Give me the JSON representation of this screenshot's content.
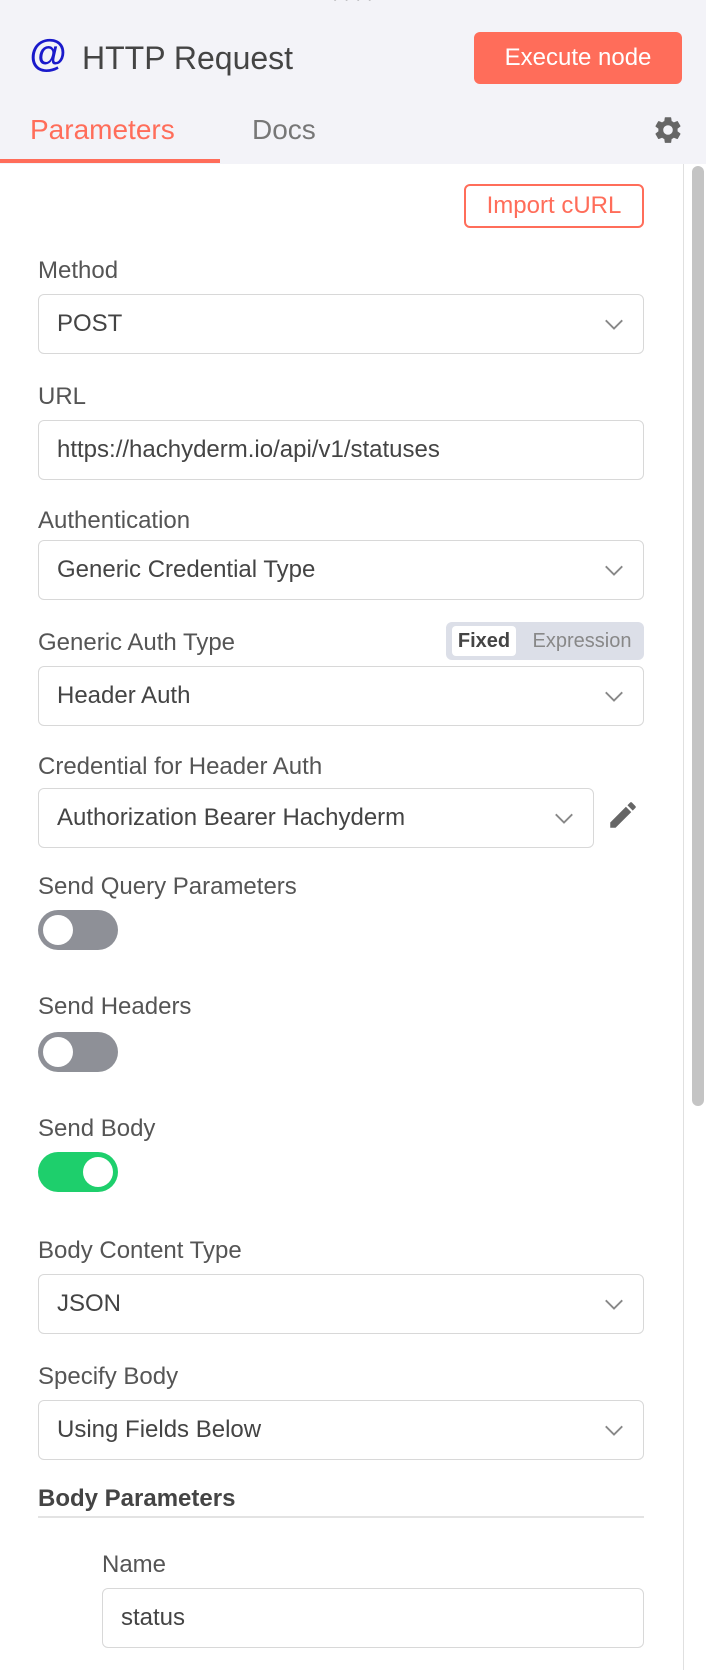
{
  "header": {
    "drag_handle": "• • • •",
    "node_icon": "at-icon",
    "title": "HTTP Request",
    "execute_label": "Execute node",
    "tabs": [
      {
        "label": "Parameters",
        "active": true
      },
      {
        "label": "Docs",
        "active": false
      }
    ],
    "settings_icon": "gear-icon"
  },
  "colors": {
    "accent": "#ff6d5a",
    "toggle_on": "#1ecf6c",
    "toggle_off": "#8e9097",
    "node_icon": "#1a1acb"
  },
  "form": {
    "import_curl_label": "Import cURL",
    "method": {
      "label": "Method",
      "value": "POST"
    },
    "url": {
      "label": "URL",
      "value": "https://hachyderm.io/api/v1/statuses"
    },
    "authentication": {
      "label": "Authentication",
      "value": "Generic Credential Type"
    },
    "generic_auth_type": {
      "label": "Generic Auth Type",
      "value": "Header Auth",
      "mode_fixed": "Fixed",
      "mode_expression": "Expression",
      "selected_mode": "Fixed"
    },
    "credential": {
      "label": "Credential for Header Auth",
      "value": "Authorization Bearer Hachyderm"
    },
    "send_query": {
      "label": "Send Query Parameters",
      "on": false
    },
    "send_headers": {
      "label": "Send Headers",
      "on": false
    },
    "send_body": {
      "label": "Send Body",
      "on": true
    },
    "body_content_type": {
      "label": "Body Content Type",
      "value": "JSON"
    },
    "specify_body": {
      "label": "Specify Body",
      "value": "Using Fields Below"
    },
    "body_parameters": {
      "title": "Body Parameters",
      "name_label": "Name",
      "name_value": "status"
    }
  }
}
